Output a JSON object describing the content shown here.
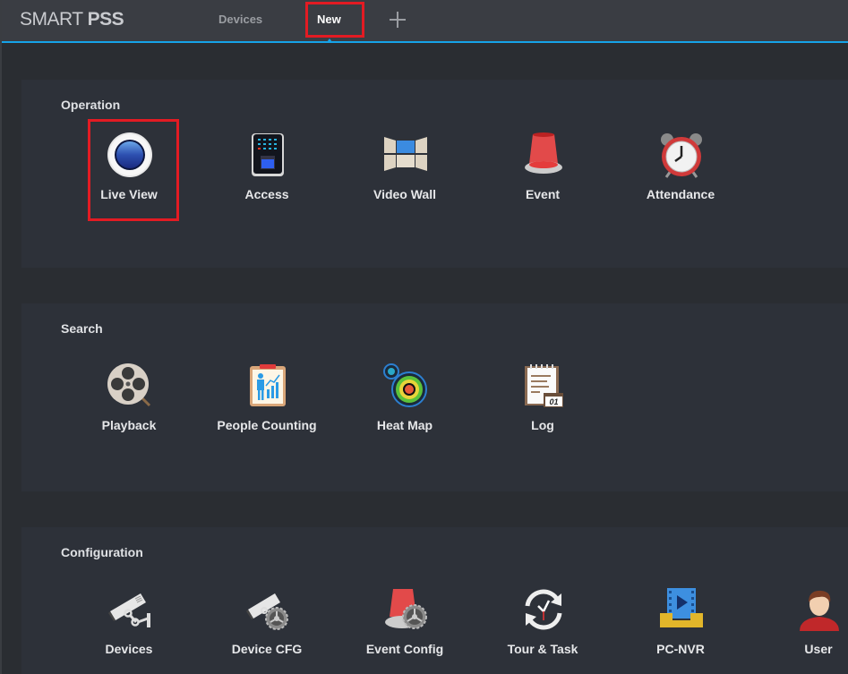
{
  "app": {
    "logo_light": "SMART ",
    "logo_bold": "PSS"
  },
  "tabs": [
    {
      "label": "Devices",
      "active": false
    },
    {
      "label": "New",
      "active": true
    }
  ],
  "add_tab_icon": "plus-icon",
  "accent_color": "#16a3e8",
  "highlight_color": "#e31b23",
  "sections": [
    {
      "title": "Operation",
      "items": [
        {
          "label": "Live View",
          "icon": "live-view-icon",
          "highlighted": true
        },
        {
          "label": "Access",
          "icon": "access-control-icon"
        },
        {
          "label": "Video Wall",
          "icon": "video-wall-icon"
        },
        {
          "label": "Event",
          "icon": "alarm-light-icon"
        },
        {
          "label": "Attendance",
          "icon": "alarm-clock-icon"
        }
      ]
    },
    {
      "title": "Search",
      "items": [
        {
          "label": "Playback",
          "icon": "film-reel-icon"
        },
        {
          "label": "People Counting",
          "icon": "people-counting-icon"
        },
        {
          "label": "Heat Map",
          "icon": "heat-map-icon"
        },
        {
          "label": "Log",
          "icon": "log-notepad-icon"
        }
      ]
    },
    {
      "title": "Configuration",
      "items": [
        {
          "label": "Devices",
          "icon": "camera-icon"
        },
        {
          "label": "Device CFG",
          "icon": "camera-gear-icon"
        },
        {
          "label": "Event Config",
          "icon": "alarm-gear-icon"
        },
        {
          "label": "Tour & Task",
          "icon": "clock-cycle-icon"
        },
        {
          "label": "PC-NVR",
          "icon": "pc-nvr-icon"
        },
        {
          "label": "User",
          "icon": "user-icon"
        }
      ]
    }
  ],
  "log_icon_text": "01"
}
